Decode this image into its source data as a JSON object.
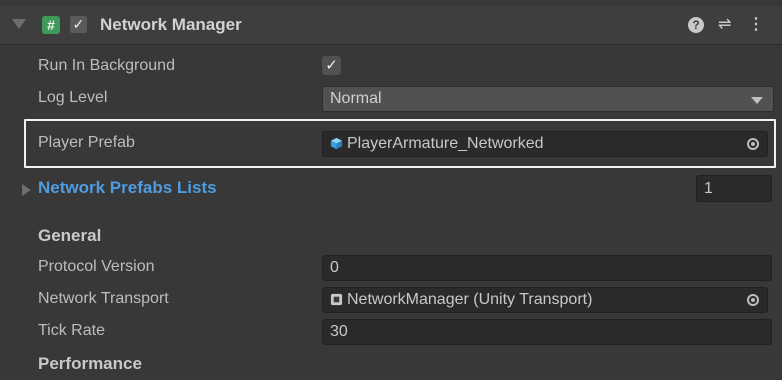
{
  "header": {
    "script_icon_glyph": "#",
    "title": "Network Manager",
    "help_glyph": "?",
    "presets_glyph": "⇌",
    "menu_glyph": "⋮",
    "enabled": true
  },
  "fields": {
    "run_in_background": {
      "label": "Run In Background",
      "checked": true
    },
    "log_level": {
      "label": "Log Level",
      "value": "Normal"
    },
    "player_prefab": {
      "label": "Player Prefab",
      "value": "PlayerArmature_Networked"
    },
    "network_prefabs_lists": {
      "label": "Network Prefabs Lists",
      "count": "1"
    },
    "general": {
      "title": "General"
    },
    "protocol_version": {
      "label": "Protocol Version",
      "value": "0"
    },
    "network_transport": {
      "label": "Network Transport",
      "value": "NetworkManager (Unity Transport)"
    },
    "tick_rate": {
      "label": "Tick Rate",
      "value": "30"
    },
    "performance": {
      "title": "Performance"
    }
  },
  "colors": {
    "panel_bg": "#383838",
    "accent_link": "#4f9ce0",
    "script_icon": "#3f9a5a",
    "highlight_border": "#f2f2f2"
  },
  "check_glyph": "✓"
}
